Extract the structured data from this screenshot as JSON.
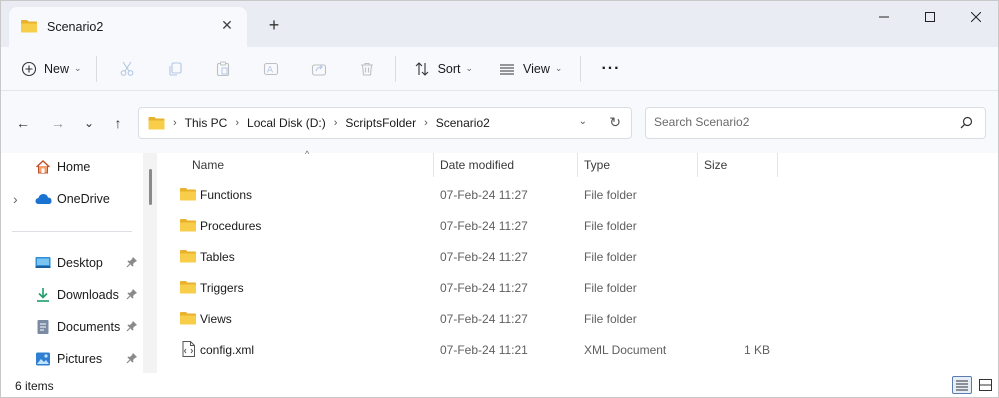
{
  "window": {
    "tab_title": "Scenario2",
    "tab_close": "✕",
    "new_tab": "+",
    "minimize": "—",
    "maximize": "☐",
    "close": "✕"
  },
  "toolbar": {
    "new_label": "New",
    "sort_label": "Sort",
    "view_label": "View",
    "more_label": "···",
    "icons": [
      "plus-circle-icon",
      "cut-icon",
      "copy-icon",
      "paste-icon",
      "rename-icon",
      "share-icon",
      "delete-icon",
      "sort-icon",
      "view-icon",
      "more-icon"
    ]
  },
  "navigation": {
    "back": "←",
    "forward": "→",
    "recent": "⌄",
    "up": "↑"
  },
  "address": {
    "breadcrumbs": [
      "This PC",
      "Local Disk (D:)",
      "ScriptsFolder",
      "Scenario2"
    ],
    "separator": "›",
    "dropdown": "⌄",
    "refresh": "↻"
  },
  "search": {
    "placeholder": "Search Scenario2",
    "value": ""
  },
  "sidebar": {
    "items": [
      {
        "label": "Home",
        "icon": "home-icon"
      },
      {
        "label": "OneDrive",
        "icon": "cloud-icon",
        "expandable": true
      },
      {
        "label": "Desktop",
        "icon": "desktop-icon",
        "pinned": true
      },
      {
        "label": "Downloads",
        "icon": "download-icon",
        "pinned": true
      },
      {
        "label": "Documents",
        "icon": "documents-icon",
        "pinned": true
      },
      {
        "label": "Pictures",
        "icon": "pictures-icon",
        "pinned": true
      }
    ],
    "expand_glyph": "›"
  },
  "file_list": {
    "columns": [
      "Name",
      "Date modified",
      "Type",
      "Size"
    ],
    "sort_indicator": "^",
    "rows": [
      {
        "name": "Functions",
        "date": "07-Feb-24 11:27",
        "type": "File folder",
        "size": "",
        "icon": "folder-icon"
      },
      {
        "name": "Procedures",
        "date": "07-Feb-24 11:27",
        "type": "File folder",
        "size": "",
        "icon": "folder-icon"
      },
      {
        "name": "Tables",
        "date": "07-Feb-24 11:27",
        "type": "File folder",
        "size": "",
        "icon": "folder-icon"
      },
      {
        "name": "Triggers",
        "date": "07-Feb-24 11:27",
        "type": "File folder",
        "size": "",
        "icon": "folder-icon"
      },
      {
        "name": "Views",
        "date": "07-Feb-24 11:27",
        "type": "File folder",
        "size": "",
        "icon": "folder-icon"
      },
      {
        "name": "config.xml",
        "date": "07-Feb-24 11:21",
        "type": "XML Document",
        "size": "1 KB",
        "icon": "xml-file-icon"
      }
    ]
  },
  "status": {
    "item_count": "6 items",
    "view_mode": "details"
  },
  "colors": {
    "folder": "#f4c542",
    "accent": "#0a64c8",
    "chrome": "#e9edf3"
  }
}
